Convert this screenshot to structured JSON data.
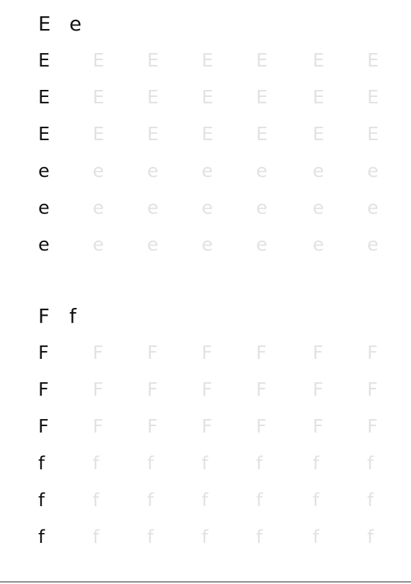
{
  "sections": [
    {
      "id": "e",
      "upper": "E",
      "lower": "e",
      "rows": [
        {
          "model": "E",
          "trace": [
            "E",
            "E",
            "E",
            "E",
            "E",
            "E"
          ]
        },
        {
          "model": "E",
          "trace": [
            "E",
            "E",
            "E",
            "E",
            "E",
            "E"
          ]
        },
        {
          "model": "E",
          "trace": [
            "E",
            "E",
            "E",
            "E",
            "E",
            "E"
          ]
        },
        {
          "model": "e",
          "trace": [
            "e",
            "e",
            "e",
            "e",
            "e",
            "e"
          ]
        },
        {
          "model": "e",
          "trace": [
            "e",
            "e",
            "e",
            "e",
            "e",
            "e"
          ]
        },
        {
          "model": "e",
          "trace": [
            "e",
            "e",
            "e",
            "e",
            "e",
            "e"
          ]
        }
      ]
    },
    {
      "id": "f",
      "upper": "F",
      "lower": "f",
      "rows": [
        {
          "model": "F",
          "trace": [
            "F",
            "F",
            "F",
            "F",
            "F",
            "F"
          ]
        },
        {
          "model": "F",
          "trace": [
            "F",
            "F",
            "F",
            "F",
            "F",
            "F"
          ]
        },
        {
          "model": "F",
          "trace": [
            "F",
            "F",
            "F",
            "F",
            "F",
            "F"
          ]
        },
        {
          "model": "f",
          "trace": [
            "f",
            "f",
            "f",
            "f",
            "f",
            "f"
          ]
        },
        {
          "model": "f",
          "trace": [
            "f",
            "f",
            "f",
            "f",
            "f",
            "f"
          ]
        },
        {
          "model": "f",
          "trace": [
            "f",
            "f",
            "f",
            "f",
            "f",
            "f"
          ]
        }
      ]
    }
  ],
  "colors": {
    "model_letter": "#111111",
    "trace_letter": "#e2e2e2",
    "rule": "#8a8a8a"
  }
}
